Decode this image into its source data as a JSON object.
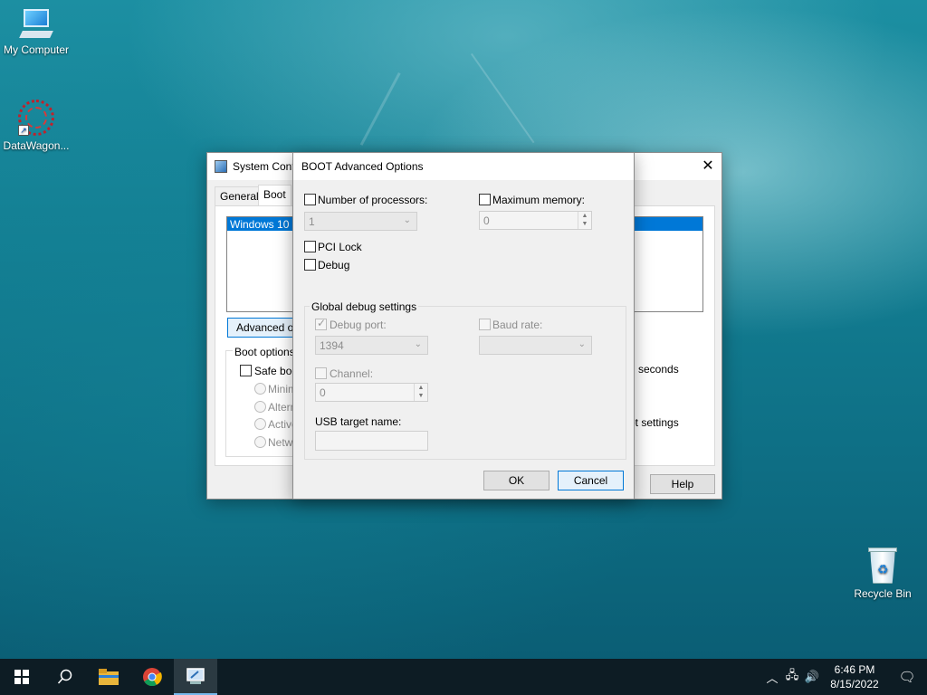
{
  "desktop": {
    "icons": [
      {
        "label": "My Computer",
        "icon": "computer-icon"
      },
      {
        "label": "DataWagon...",
        "icon": "datawagon-icon"
      },
      {
        "label": "Recycle Bin",
        "icon": "recycle-bin-icon"
      }
    ]
  },
  "sysconfig": {
    "title": "System Conf",
    "tabs": [
      "General",
      "Boot"
    ],
    "boot_entry": "Windows 10 (C",
    "advanced_button": "Advanced op",
    "boot_options_label": "Boot options",
    "safe_boot_label": "Safe boo",
    "radio_options": [
      "Minima",
      "Altern",
      "Active",
      "Netwo"
    ],
    "seconds_label": "seconds",
    "boot_settings_label": "ot settings",
    "help_button": "Help"
  },
  "dialog": {
    "title": "BOOT Advanced Options",
    "num_processors_label": "Number of processors:",
    "num_processors_value": "1",
    "max_memory_label": "Maximum memory:",
    "max_memory_value": "0",
    "pci_lock_label": "PCI Lock",
    "debug_label": "Debug",
    "global_debug_label": "Global debug settings",
    "debug_port_label": "Debug port:",
    "debug_port_value": "1394",
    "baud_rate_label": "Baud rate:",
    "baud_rate_value": "",
    "channel_label": "Channel:",
    "channel_value": "0",
    "usb_target_label": "USB target name:",
    "usb_target_value": "",
    "ok_button": "OK",
    "cancel_button": "Cancel"
  },
  "taskbar": {
    "time": "6:46 PM",
    "date": "8/15/2022"
  },
  "colors": {
    "selection": "#0078d7",
    "taskbar": "#0d1c24"
  }
}
